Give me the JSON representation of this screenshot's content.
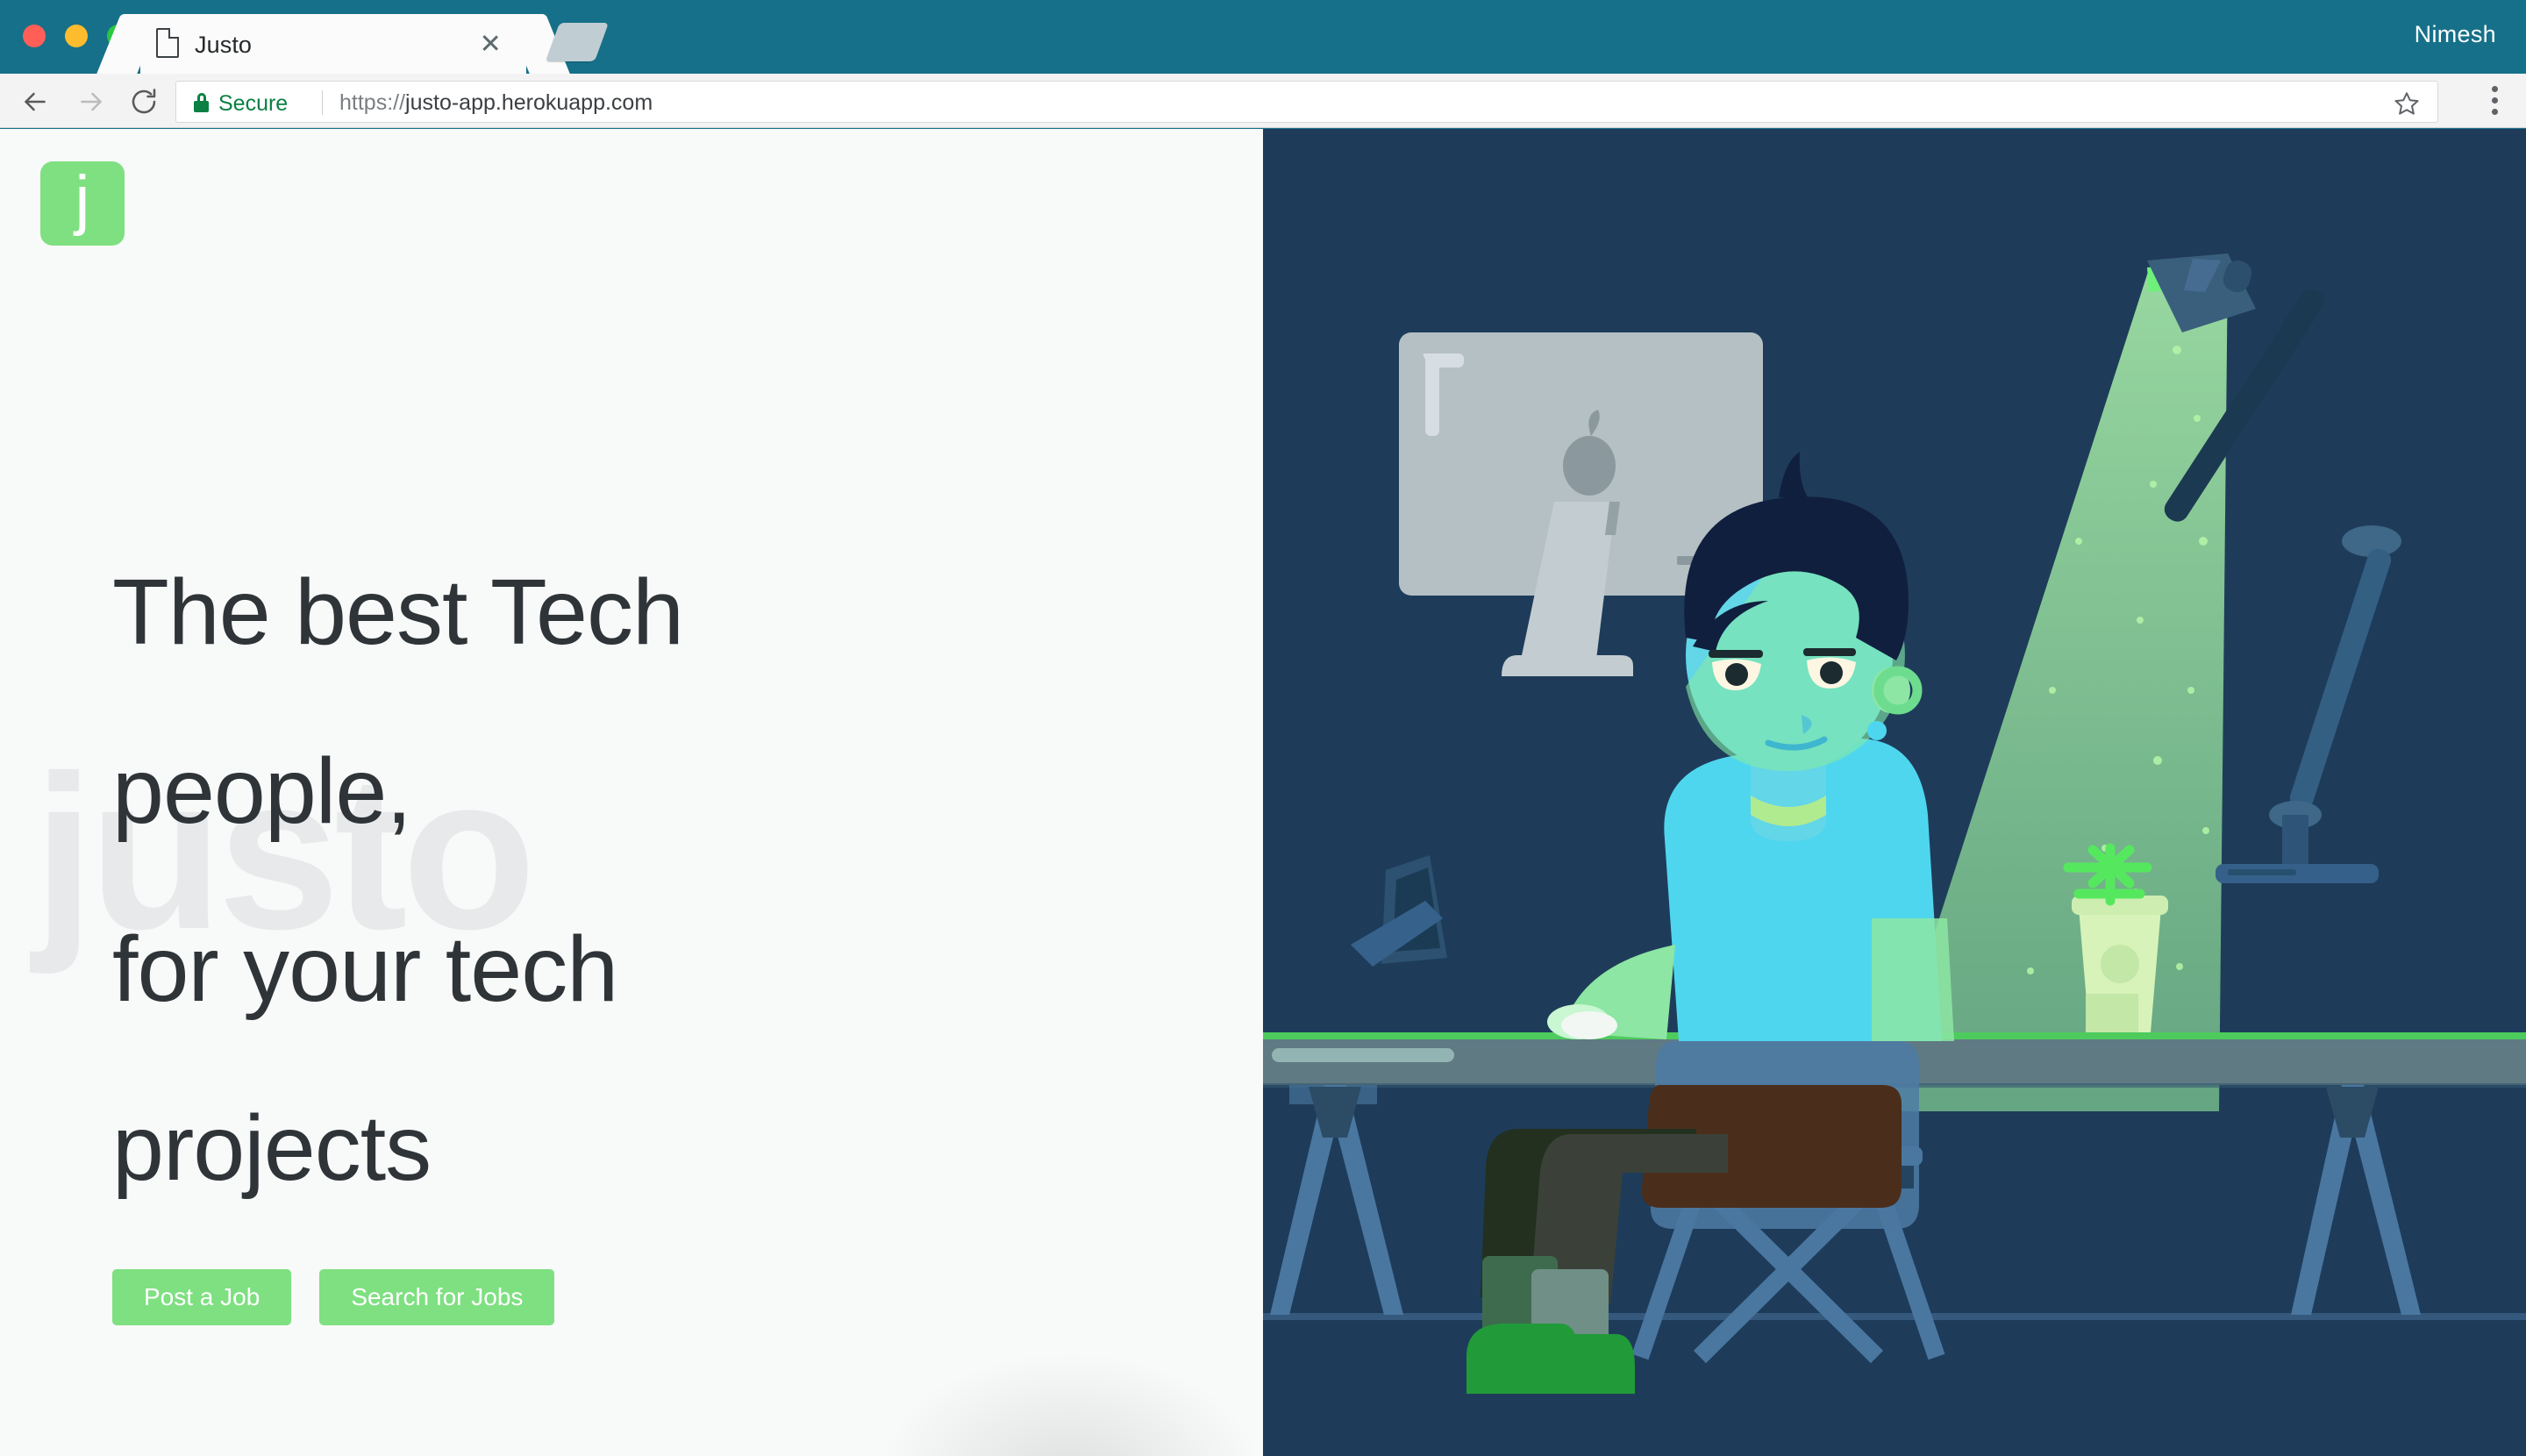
{
  "browser": {
    "window_controls": [
      "close",
      "minimize",
      "maximize"
    ],
    "tab": {
      "title": "Justo",
      "favicon": "page-icon",
      "close": "×"
    },
    "new_tab_label": "+",
    "profile_name": "Nimesh",
    "toolbar": {
      "back": "←",
      "forward": "→",
      "reload": "⟳",
      "security_label": "Secure",
      "url_scheme": "https://",
      "url_host": "justo-app.herokuapp.com",
      "url_full": "https://justo-app.herokuapp.com",
      "bookmark": "☆",
      "menu": "⋮"
    }
  },
  "page": {
    "logo_letter": "j",
    "watermark": "justo",
    "heading_lines": [
      "The best Tech",
      "people,",
      "for your tech",
      "projects"
    ],
    "buttons": {
      "post_job": "Post a Job",
      "search_jobs": "Search for Jobs"
    },
    "illustration": {
      "alt": "Person working at a desk with an iMac under a desk lamp at night",
      "elements": [
        "imac",
        "laptop",
        "desk",
        "desk-lamp",
        "light-cone",
        "coffee-cup",
        "person",
        "chair"
      ]
    }
  },
  "colors": {
    "browser_chrome": "#167089",
    "toolbar": "#f3f3f3",
    "accent_green": "#7ee081",
    "secure_green": "#0a8043",
    "hero_bg": "#f8f9f9",
    "heading_text": "#2f3438",
    "watermark": "#e7e9ea",
    "illustration_bg": "#1e3c5a",
    "light_cone": "#8ed49a",
    "skin": "#63d6e8",
    "hair": "#111f3e",
    "shoes": "#219a3a"
  }
}
